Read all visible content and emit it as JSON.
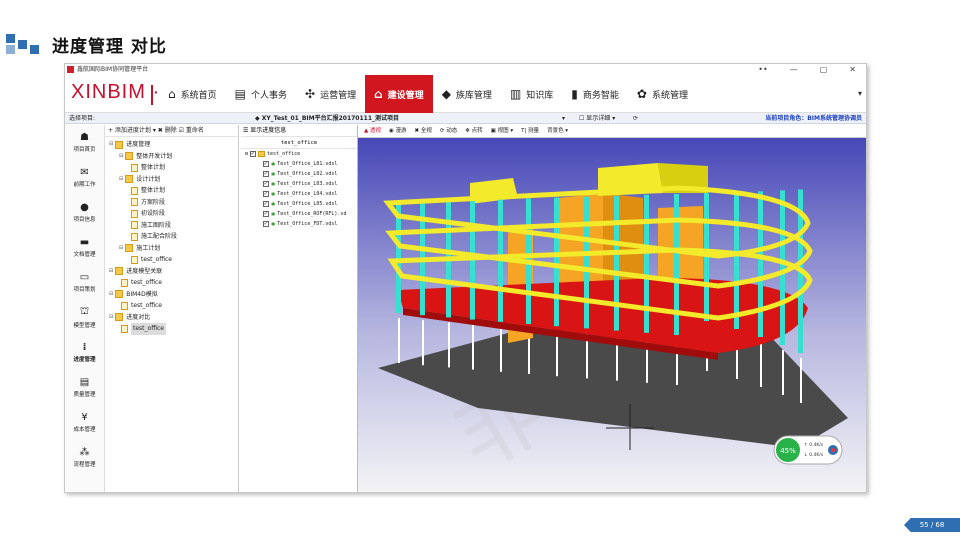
{
  "slide": {
    "title": "进度管理 对比",
    "page": "55 / 68"
  },
  "app": {
    "window_title": "鑫航国际BIM协同管理平台",
    "window_controls": [
      "••",
      "—",
      "▢",
      "✕"
    ],
    "brand": "XINBIM ·",
    "menu": [
      {
        "label": "系统首页",
        "icon": "⌂",
        "active": false
      },
      {
        "label": "个人事务",
        "icon": "▤",
        "active": false
      },
      {
        "label": "运营管理",
        "icon": "✣",
        "active": false
      },
      {
        "label": "建设管理",
        "icon": "⌂",
        "active": true
      },
      {
        "label": "族库管理",
        "icon": "◆",
        "active": false
      },
      {
        "label": "知识库",
        "icon": "▥",
        "active": false
      },
      {
        "label": "商务智能",
        "icon": "▮",
        "active": false
      },
      {
        "label": "系统管理",
        "icon": "✿",
        "active": false
      }
    ],
    "menu_caret": "▾",
    "project_bar": {
      "label": "选择项目:",
      "project": "◆ XY_Test_01_BIM平台汇报20170111_测试项目",
      "caret": "▾",
      "detail_toggle": "☐ 显示详细 ▾",
      "refresh": "⟳",
      "role": "当前项目角色：BIM系统管理协调员"
    },
    "sidebar": [
      {
        "label": "项目首页",
        "icon": "☗"
      },
      {
        "label": "前期工作",
        "icon": "✉"
      },
      {
        "label": "项目信息",
        "icon": "●"
      },
      {
        "label": "文档管理",
        "icon": "▬"
      },
      {
        "label": "项目策划",
        "icon": "▭"
      },
      {
        "label": "模型管理",
        "icon": "⛫"
      },
      {
        "label": "进度管理",
        "icon": "⁞"
      },
      {
        "label": "质量管理",
        "icon": "▤"
      },
      {
        "label": "成本管理",
        "icon": "¥"
      },
      {
        "label": "流程管理",
        "icon": "⁂"
      }
    ],
    "tree_toolbar": "+ 添加进度计划 ▾  ✖ 删除  ☑ 重命名",
    "tree": [
      {
        "label": "进度管理",
        "level": 0,
        "type": "folder",
        "toggle": "⊟"
      },
      {
        "label": "整体开发计划",
        "level": 1,
        "type": "folder",
        "toggle": "⊟"
      },
      {
        "label": "整体计划",
        "level": 2,
        "type": "doc",
        "toggle": ""
      },
      {
        "label": "设计计划",
        "level": 1,
        "type": "folder",
        "toggle": "⊟"
      },
      {
        "label": "整体计划",
        "level": 2,
        "type": "doc",
        "toggle": ""
      },
      {
        "label": "方案阶段",
        "level": 2,
        "type": "doc",
        "toggle": ""
      },
      {
        "label": "初设阶段",
        "level": 2,
        "type": "doc",
        "toggle": ""
      },
      {
        "label": "施工图阶段",
        "level": 2,
        "type": "doc",
        "toggle": ""
      },
      {
        "label": "施工配合阶段",
        "level": 2,
        "type": "doc",
        "toggle": ""
      },
      {
        "label": "施工计划",
        "level": 1,
        "type": "folder",
        "toggle": "⊟"
      },
      {
        "label": "test_office",
        "level": 2,
        "type": "doc",
        "toggle": ""
      },
      {
        "label": "进度模型关联",
        "level": 0,
        "type": "folder",
        "toggle": "⊟"
      },
      {
        "label": "test_office",
        "level": 1,
        "type": "doc",
        "toggle": ""
      },
      {
        "label": "BIM4D模拟",
        "level": 0,
        "type": "folder",
        "toggle": "⊟"
      },
      {
        "label": "test_office",
        "level": 1,
        "type": "doc",
        "toggle": ""
      },
      {
        "label": "进度对比",
        "level": 0,
        "type": "folder",
        "toggle": "⊟"
      },
      {
        "label": "test_office",
        "level": 1,
        "type": "doc",
        "toggle": "",
        "selected": true
      }
    ],
    "model_panel": {
      "toolbar": "☰ 显示进度信息",
      "header": "test_office",
      "root": "test_office",
      "items": [
        "Test_Office_L01.vdsl",
        "Test_Office_L02.vdsl",
        "Test_Office_L03.vdsl",
        "Test_Office_L04.vdsl",
        "Test_Office_L05.vdsl",
        "Test_Office_ROF(RFL).vd",
        "Test_Office_FDT.vdsl"
      ]
    },
    "viewer_toolbar": [
      {
        "label": "▲ 透视",
        "red": true
      },
      {
        "label": "◉ 漫游",
        "red": false
      },
      {
        "label": "✖ 全视",
        "red": false
      },
      {
        "label": "⟳ 动态",
        "red": false
      },
      {
        "label": "✥ 点转",
        "red": false
      },
      {
        "label": "▣ 视图 ▾",
        "red": false
      },
      {
        "label": "T| 测量",
        "red": false
      },
      {
        "label": "背景色 ▾",
        "red": false
      }
    ],
    "nav_widget": {
      "percent": "45%",
      "stat1": "0.4K/s",
      "stat2": "0.4K/s"
    }
  },
  "colors": {
    "accent_red": "#d0161e",
    "brand_blue": "#2f6fb1",
    "viewer_bg_top": "#4747b8",
    "viewer_bg_bottom": "#f2f2f2",
    "floor_yellow": "#f2ea2a",
    "column_cyan": "#36e0d0",
    "highlight_red": "#d81414",
    "core_orange": "#f5a523"
  }
}
